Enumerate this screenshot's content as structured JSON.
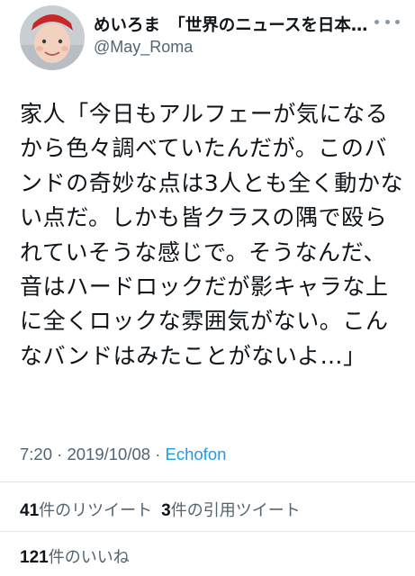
{
  "author": {
    "display_name": "めいろま　「世界のニュースを日本人は何も知らない」",
    "handle": "@May_Roma"
  },
  "tweet": {
    "text": "家人「今日もアルフェーが気になるから色々調べていたんだが。このバンドの奇妙な点は3人とも全く動かない点だ。しかも皆クラスの隅で殴られていそうな感じで。そうなんだ、音はハードロックだが影キャラな上に全くロックな雰囲気がない。こんなバンドはみたことがないよ…」",
    "time": "7:20",
    "date": "2019/10/08",
    "separator": "·",
    "source": "Echofon"
  },
  "stats": {
    "retweets_count": "41",
    "retweets_label": "件のリツイート",
    "quotes_count": "3",
    "quotes_label": "件の引用ツイート",
    "likes_count": "121",
    "likes_label": "件のいいね"
  },
  "icons": {
    "more": "more-dots-icon",
    "avatar": "baby-photo-avatar"
  },
  "colors": {
    "text": "#0f1419",
    "secondary": "#536471",
    "link": "#1d9bf0",
    "divider": "#e1e5e8"
  }
}
